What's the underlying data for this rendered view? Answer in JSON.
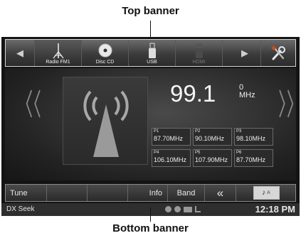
{
  "callouts": {
    "top": "Top banner",
    "bottom": "Bottom banner"
  },
  "top_banner": {
    "prev_icon": "arrow-left-icon",
    "next_icon": "arrow-right-icon",
    "sources": [
      {
        "label": "Radio FM1",
        "icon": "antenna-icon",
        "active": true
      },
      {
        "label": "Disc CD",
        "icon": "disc-icon",
        "active": false
      },
      {
        "label": "USB",
        "icon": "usb-icon",
        "active": false
      },
      {
        "label": "HDMI",
        "icon": "hdmi-icon",
        "active": false
      }
    ],
    "settings_icon": "wrench-screwdriver-icon"
  },
  "radio": {
    "frequency": "99.1",
    "subchannel": "0",
    "unit": "MHz",
    "presets": [
      {
        "number": "P1",
        "frequency": "87.70MHz"
      },
      {
        "number": "P2",
        "frequency": "90.10MHz"
      },
      {
        "number": "P3",
        "frequency": "98.10MHz"
      },
      {
        "number": "P4",
        "frequency": "106.10MHz"
      },
      {
        "number": "P5",
        "frequency": "107.90MHz"
      },
      {
        "number": "P6",
        "frequency": "87.70MHz"
      }
    ]
  },
  "bottom_banner": {
    "tune": "Tune",
    "info": "Info",
    "band": "Band",
    "seek_back": "«",
    "mode_letter": "A"
  },
  "status_bar": {
    "mode": "DX Seek",
    "time": "12:18 PM"
  },
  "colors": {
    "screen_bg": "#141414",
    "text": "#f5f5f5"
  }
}
